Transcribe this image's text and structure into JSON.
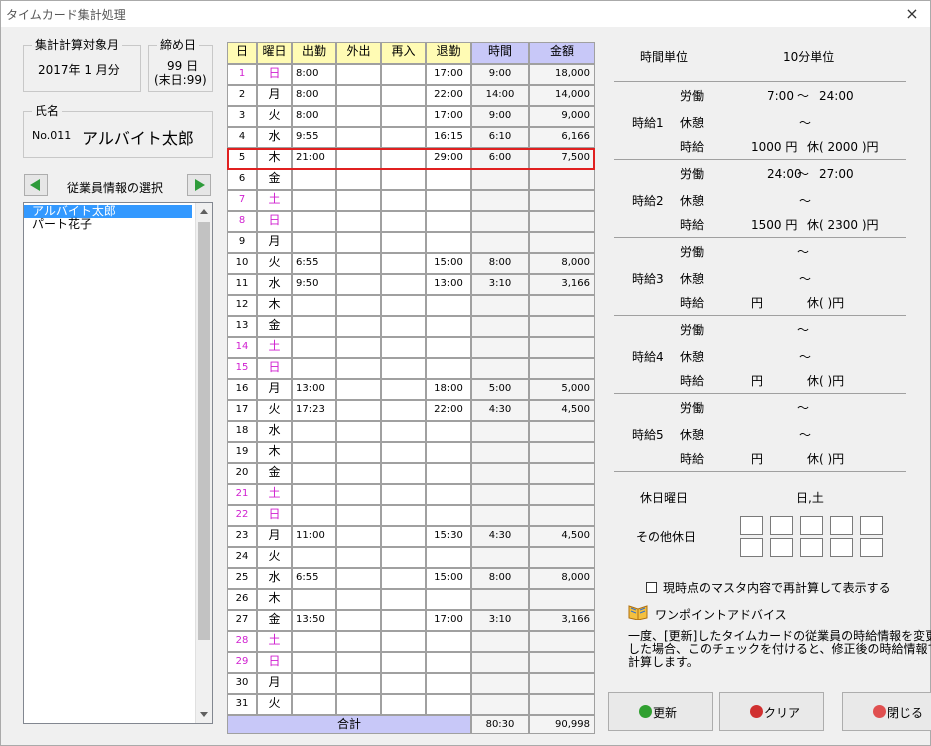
{
  "window": {
    "title": "タイムカード集計処理",
    "close": "×"
  },
  "period": {
    "label": "集計計算対象月",
    "value": "2017年 1 月分"
  },
  "closing": {
    "label": "締め日",
    "value": "99 日",
    "note": "(末日:99)"
  },
  "employee": {
    "label": "氏名",
    "no": "No.011",
    "name": "アルバイト太郎"
  },
  "employee_select": {
    "label": "従業員情報の選択",
    "items": [
      "アルバイト太郎",
      "パート花子"
    ],
    "selected": "アルバイト太郎"
  },
  "table": {
    "headers": [
      "日",
      "曜日",
      "出勤",
      "外出",
      "再入",
      "退勤",
      "時間",
      "金額"
    ],
    "rows": [
      {
        "d": "1",
        "w": "日",
        "in": "8:00",
        "out": "",
        "re": "",
        "end": "17:00",
        "t": "9:00",
        "a": "18,000",
        "pink": true
      },
      {
        "d": "2",
        "w": "月",
        "in": "8:00",
        "out": "",
        "re": "",
        "end": "22:00",
        "t": "14:00",
        "a": "14,000",
        "pink": false
      },
      {
        "d": "3",
        "w": "火",
        "in": "8:00",
        "out": "",
        "re": "",
        "end": "17:00",
        "t": "9:00",
        "a": "9,000",
        "pink": false
      },
      {
        "d": "4",
        "w": "水",
        "in": "9:55",
        "out": "",
        "re": "",
        "end": "16:15",
        "t": "6:10",
        "a": "6,166",
        "pink": false
      },
      {
        "d": "5",
        "w": "木",
        "in": "21:00",
        "out": "",
        "re": "",
        "end": "29:00",
        "t": "6:00",
        "a": "7,500",
        "pink": false
      },
      {
        "d": "6",
        "w": "金",
        "in": "",
        "out": "",
        "re": "",
        "end": "",
        "t": "",
        "a": "",
        "pink": false
      },
      {
        "d": "7",
        "w": "土",
        "in": "",
        "out": "",
        "re": "",
        "end": "",
        "t": "",
        "a": "",
        "pink": true
      },
      {
        "d": "8",
        "w": "日",
        "in": "",
        "out": "",
        "re": "",
        "end": "",
        "t": "",
        "a": "",
        "pink": true
      },
      {
        "d": "9",
        "w": "月",
        "in": "",
        "out": "",
        "re": "",
        "end": "",
        "t": "",
        "a": "",
        "pink": false
      },
      {
        "d": "10",
        "w": "火",
        "in": "6:55",
        "out": "",
        "re": "",
        "end": "15:00",
        "t": "8:00",
        "a": "8,000",
        "pink": false
      },
      {
        "d": "11",
        "w": "水",
        "in": "9:50",
        "out": "",
        "re": "",
        "end": "13:00",
        "t": "3:10",
        "a": "3,166",
        "pink": false
      },
      {
        "d": "12",
        "w": "木",
        "in": "",
        "out": "",
        "re": "",
        "end": "",
        "t": "",
        "a": "",
        "pink": false
      },
      {
        "d": "13",
        "w": "金",
        "in": "",
        "out": "",
        "re": "",
        "end": "",
        "t": "",
        "a": "",
        "pink": false
      },
      {
        "d": "14",
        "w": "土",
        "in": "",
        "out": "",
        "re": "",
        "end": "",
        "t": "",
        "a": "",
        "pink": true
      },
      {
        "d": "15",
        "w": "日",
        "in": "",
        "out": "",
        "re": "",
        "end": "",
        "t": "",
        "a": "",
        "pink": true
      },
      {
        "d": "16",
        "w": "月",
        "in": "13:00",
        "out": "",
        "re": "",
        "end": "18:00",
        "t": "5:00",
        "a": "5,000",
        "pink": false
      },
      {
        "d": "17",
        "w": "火",
        "in": "17:23",
        "out": "",
        "re": "",
        "end": "22:00",
        "t": "4:30",
        "a": "4,500",
        "pink": false
      },
      {
        "d": "18",
        "w": "水",
        "in": "",
        "out": "",
        "re": "",
        "end": "",
        "t": "",
        "a": "",
        "pink": false
      },
      {
        "d": "19",
        "w": "木",
        "in": "",
        "out": "",
        "re": "",
        "end": "",
        "t": "",
        "a": "",
        "pink": false
      },
      {
        "d": "20",
        "w": "金",
        "in": "",
        "out": "",
        "re": "",
        "end": "",
        "t": "",
        "a": "",
        "pink": false
      },
      {
        "d": "21",
        "w": "土",
        "in": "",
        "out": "",
        "re": "",
        "end": "",
        "t": "",
        "a": "",
        "pink": true
      },
      {
        "d": "22",
        "w": "日",
        "in": "",
        "out": "",
        "re": "",
        "end": "",
        "t": "",
        "a": "",
        "pink": true
      },
      {
        "d": "23",
        "w": "月",
        "in": "11:00",
        "out": "",
        "re": "",
        "end": "15:30",
        "t": "4:30",
        "a": "4,500",
        "pink": false
      },
      {
        "d": "24",
        "w": "火",
        "in": "",
        "out": "",
        "re": "",
        "end": "",
        "t": "",
        "a": "",
        "pink": false
      },
      {
        "d": "25",
        "w": "水",
        "in": "6:55",
        "out": "",
        "re": "",
        "end": "15:00",
        "t": "8:00",
        "a": "8,000",
        "pink": false
      },
      {
        "d": "26",
        "w": "木",
        "in": "",
        "out": "",
        "re": "",
        "end": "",
        "t": "",
        "a": "",
        "pink": false
      },
      {
        "d": "27",
        "w": "金",
        "in": "13:50",
        "out": "",
        "re": "",
        "end": "17:00",
        "t": "3:10",
        "a": "3,166",
        "pink": false
      },
      {
        "d": "28",
        "w": "土",
        "in": "",
        "out": "",
        "re": "",
        "end": "",
        "t": "",
        "a": "",
        "pink": true
      },
      {
        "d": "29",
        "w": "日",
        "in": "",
        "out": "",
        "re": "",
        "end": "",
        "t": "",
        "a": "",
        "pink": true
      },
      {
        "d": "30",
        "w": "月",
        "in": "",
        "out": "",
        "re": "",
        "end": "",
        "t": "",
        "a": "",
        "pink": false
      },
      {
        "d": "31",
        "w": "火",
        "in": "",
        "out": "",
        "re": "",
        "end": "",
        "t": "",
        "a": "",
        "pink": false
      }
    ],
    "total_label": "合計",
    "total_time": "80:30",
    "total_amount": "90,998",
    "highlighted_day": "5"
  },
  "rates": {
    "unit_label": "時間単位",
    "unit_value": "10分単位",
    "labor": "労働",
    "rest": "休憩",
    "wage": "時給",
    "tilde": "～",
    "items": [
      {
        "name": "時給1",
        "start": "7:00",
        "end": "24:00",
        "rate": "1000 円",
        "holiday": "休(  2000 )円"
      },
      {
        "name": "時給2",
        "start": "24:00",
        "end": "27:00",
        "rate": "1500 円",
        "holiday": "休(  2300 )円"
      },
      {
        "name": "時給3",
        "start": "",
        "end": "",
        "rate": "円",
        "holiday": "休(        )円"
      },
      {
        "name": "時給4",
        "start": "",
        "end": "",
        "rate": "円",
        "holiday": "休(        )円"
      },
      {
        "name": "時給5",
        "start": "",
        "end": "",
        "rate": "円",
        "holiday": "休(        )円"
      }
    ]
  },
  "holidays": {
    "weekday_label": "休日曜日",
    "weekday_value": "日,土",
    "other_label": "その他休日"
  },
  "recalc": {
    "label": "現時点のマスタ内容で再計算して表示する",
    "checked": false
  },
  "advice": {
    "title": "ワンポイントアドバイス",
    "line1": "一度、[更新]したタイムカードの従業員の時給情報を変更",
    "line2": "した場合、このチェックを付けると、修正後の時給情報で再",
    "line3": "計算します。"
  },
  "buttons": {
    "update": "更新",
    "clear": "クリア",
    "close": "閉じる"
  },
  "colors": {
    "header_yellow": "#fffbb4",
    "header_blue": "#c8c8f8",
    "weekend_pink": "#d020d0",
    "highlight_red": "#e02020"
  }
}
